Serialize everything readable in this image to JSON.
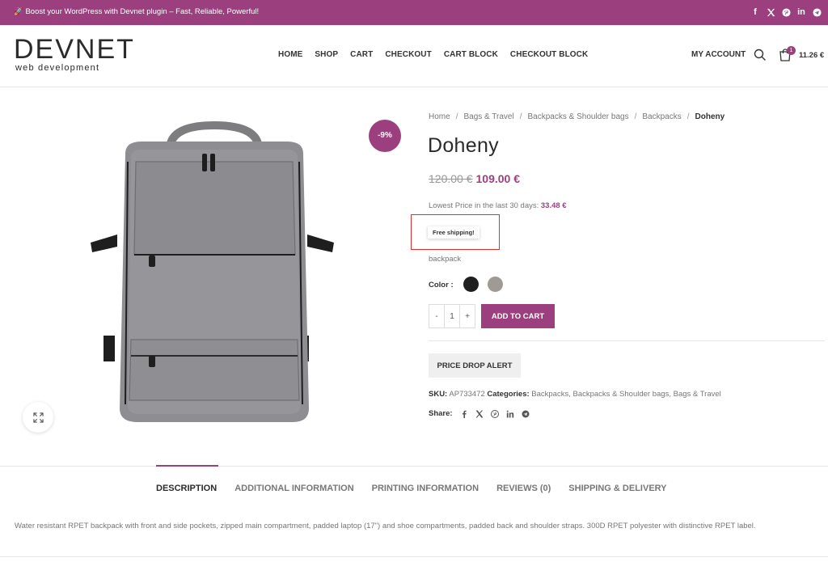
{
  "topbar": {
    "promo": "🚀 Boost your WordPress with Devnet plugin – Fast, Reliable, Powerful!",
    "socials": [
      "facebook-icon",
      "x-icon",
      "pinterest-icon",
      "linkedin-icon",
      "telegram-icon"
    ]
  },
  "header": {
    "logo_text": "DEVNET",
    "logo_sub": "web development",
    "nav": [
      "HOME",
      "SHOP",
      "CART",
      "CHECKOUT",
      "CART BLOCK",
      "CHECKOUT BLOCK"
    ],
    "account": "MY ACCOUNT",
    "cart_count": "1",
    "cart_total": "11.26 €"
  },
  "product": {
    "sale_badge": "-9%",
    "breadcrumb": [
      "Home",
      "Bags & Travel",
      "Backpacks & Shoulder bags",
      "Backpacks",
      "Doheny"
    ],
    "title": "Doheny",
    "old_price": "120.00 €",
    "new_price": "109.00 €",
    "lowest_label": "Lowest Price in the last 30 days:",
    "lowest_value": "33.48 €",
    "shipping_tag": "Free shipping!",
    "short_desc": "backpack",
    "color_label": "Color :",
    "swatches": [
      "#1f1f1f",
      "#a09a94"
    ],
    "qty_minus": "-",
    "qty_value": "1",
    "qty_plus": "+",
    "add_to_cart": "ADD TO CART",
    "price_alert": "PRICE DROP ALERT",
    "sku_label": "SKU:",
    "sku": "AP733472",
    "categories_label": "Categories:",
    "categories": [
      "Backpacks",
      "Backpacks & Shoulder bags",
      "Bags & Travel"
    ],
    "share_label": "Share:"
  },
  "tabs": {
    "items": [
      "DESCRIPTION",
      "ADDITIONAL INFORMATION",
      "PRINTING INFORMATION",
      "REVIEWS (0)",
      "SHIPPING & DELIVERY"
    ],
    "description": "Water resistant RPET backpack with front and side pockets, zipped main compartment, padded laptop (17\") and shoe compartments, padded back and shoulder straps. 300D RPET polyester with distinctive RPET label."
  },
  "colors": {
    "accent": "#9b3f7f",
    "highlight": "#e0322b"
  }
}
